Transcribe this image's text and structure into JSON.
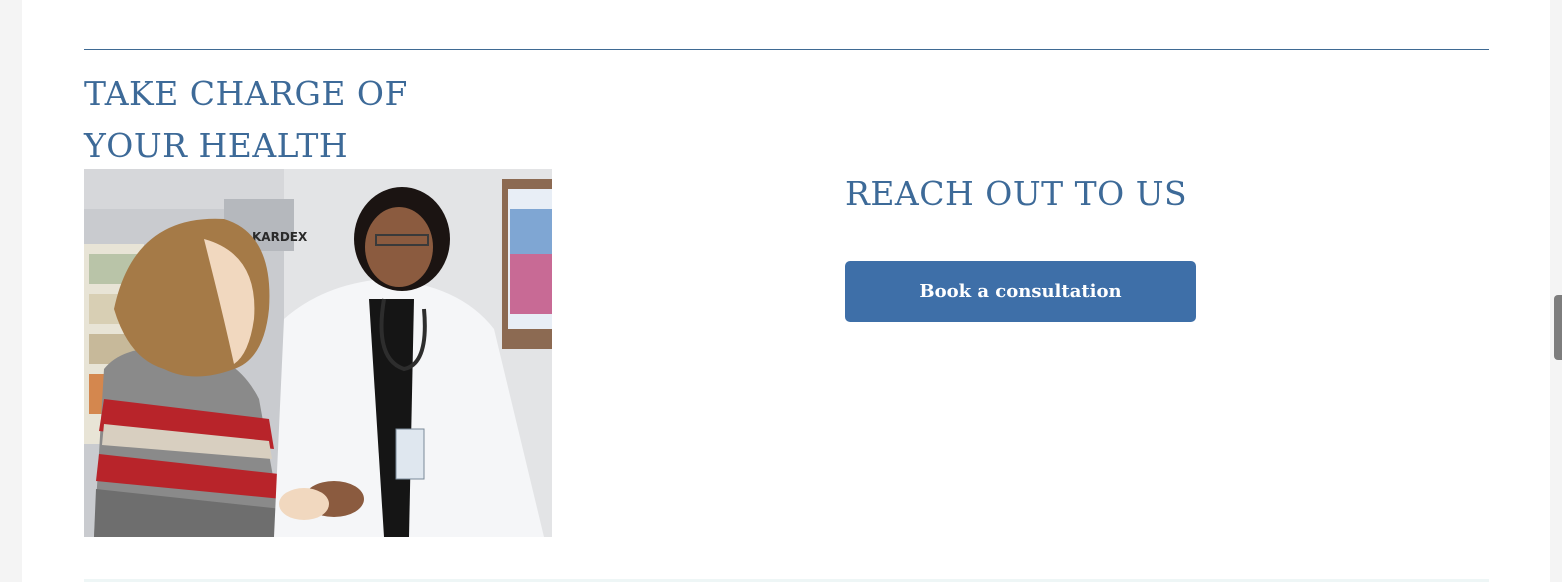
{
  "section": {
    "heading_line1": "TAKE CHARGE OF",
    "heading_line2": "YOUR HEALTH",
    "photo_alt": "KARDEX"
  },
  "contact": {
    "heading": "REACH OUT TO US",
    "button_label": "Book a consultation"
  },
  "colors": {
    "heading": "#3d6a98",
    "button": "#3e6fa8",
    "rule": "#3f6a93"
  }
}
